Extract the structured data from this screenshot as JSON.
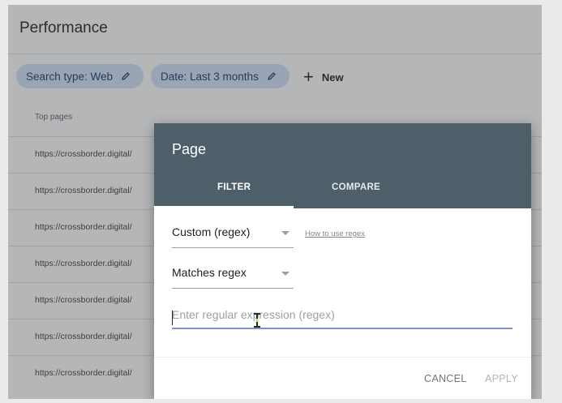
{
  "page": {
    "title": "Performance",
    "filters": {
      "search_type": "Search type: Web",
      "date": "Date: Last 3 months",
      "new_label": "New"
    },
    "table": {
      "header": "Top pages",
      "rows": [
        "https://crossborder.digital/",
        "https://crossborder.digital/",
        "https://crossborder.digital/",
        "https://crossborder.digital/",
        "https://crossborder.digital/",
        "https://crossborder.digital/",
        "https://crossborder.digital/"
      ]
    }
  },
  "dialog": {
    "title": "Page",
    "tabs": {
      "filter": "FILTER",
      "compare": "COMPARE"
    },
    "filter_type": {
      "value": "Custom (regex)"
    },
    "help_link": "How to use regex",
    "match_type": {
      "value": "Matches regex"
    },
    "regex_input": {
      "value": "",
      "placeholder": "Enter regular expression (regex)"
    },
    "buttons": {
      "cancel": "CANCEL",
      "apply": "APPLY"
    }
  },
  "colors": {
    "dialog_header": "#4e5f6a",
    "chip_bg": "#d2e3fc",
    "input_underline": "#7d95c7"
  }
}
